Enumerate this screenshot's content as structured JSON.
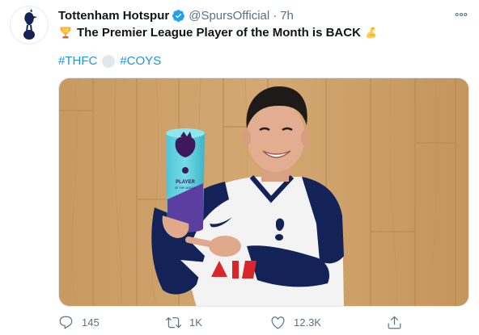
{
  "tweet": {
    "display_name": "Tottenham Hotspur",
    "verified": true,
    "handle": "@SpursOfficial",
    "separator": "·",
    "time": "7h",
    "text": "The Premier League Player of the Month is BACK",
    "emoji_before": "trophy-emoji",
    "emoji_after": "flexed-biceps-emoji",
    "hashtags": [
      "#THFC",
      "#COYS"
    ],
    "hashtag_separator_emoji": "white-circle-emoji",
    "media": {
      "trophy_label": "PLAYER",
      "trophy_sublabel": "OF THE MONTH"
    },
    "actions": {
      "replies": "145",
      "retweets": "1K",
      "likes": "12.3K"
    }
  },
  "colors": {
    "link": "#1b95e0",
    "verified": "#1da1f2",
    "muted": "#5b7083",
    "text": "#0f1419",
    "spurs_navy": "#132257"
  },
  "icons": {
    "avatar": "spurs-cockerel-logo",
    "more": "more-horizontal-icon",
    "reply": "reply-icon",
    "retweet": "retweet-icon",
    "like": "heart-icon",
    "share": "share-icon"
  }
}
